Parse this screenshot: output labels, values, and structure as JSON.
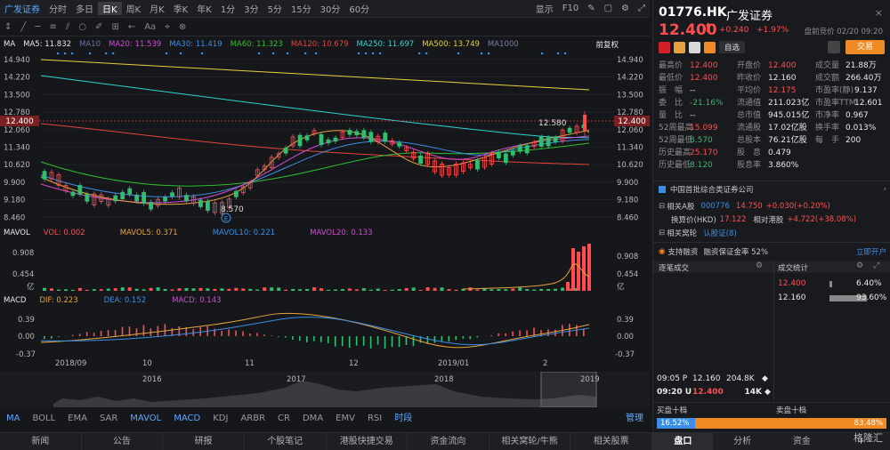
{
  "topbar": {
    "items": [
      "广发证券",
      "分时",
      "多日",
      "日K",
      "周K",
      "月K",
      "季K",
      "年K",
      "1分",
      "3分",
      "5分",
      "15分",
      "30分",
      "60分"
    ],
    "active": 3,
    "display": "显示",
    "f10": "F10"
  },
  "ma_line": {
    "label": "MA",
    "items": [
      {
        "t": "MA5: 11.832",
        "c": "#e6e6e6"
      },
      {
        "t": "MA10",
        "c": "#6f6fa0"
      },
      {
        "t": "MA20: 11.539",
        "c": "#d24bd2"
      },
      {
        "t": "MA30: 11.419",
        "c": "#3a8ee6"
      },
      {
        "t": "MA60: 11.323",
        "c": "#2fbf2f"
      },
      {
        "t": "MA120: 10.679",
        "c": "#e2463a"
      },
      {
        "t": "MA250: 11.697",
        "c": "#2fd3d3"
      },
      {
        "t": "MA500: 13.749",
        "c": "#e6d33a"
      },
      {
        "t": "MA1000",
        "c": "#7b7ba0"
      }
    ],
    "adj": "前复权"
  },
  "price_axis": [
    "14.940",
    "14.220",
    "13.500",
    "12.780",
    "12.060",
    "11.340",
    "10.620",
    "9.900",
    "9.180",
    "8.460"
  ],
  "price_marker": "12.400",
  "annot_high": "12.580",
  "annot_low": "8.570",
  "vol_line": {
    "label": "MAVOL",
    "items": [
      {
        "t": "VOL: 0.002",
        "c": "#ff4d4f"
      },
      {
        "t": "MAVOL5: 0.371",
        "c": "#e6a23c"
      },
      {
        "t": "MAVOL10: 0.221",
        "c": "#3a8ee6"
      },
      {
        "t": "MAVOL20: 0.133",
        "c": "#d24bd2"
      }
    ]
  },
  "vol_axis": [
    "0.908",
    "0.454",
    "亿"
  ],
  "macd_line": {
    "label": "MACD",
    "items": [
      {
        "t": "DIF: 0.223",
        "c": "#e6a23c"
      },
      {
        "t": "DEA: 0.152",
        "c": "#3a8ee6"
      },
      {
        "t": "MACD: 0.143",
        "c": "#d24bd2"
      }
    ]
  },
  "macd_axis": [
    "0.39",
    "0.00",
    "-0.37"
  ],
  "date_axis": [
    "2018/09",
    "10",
    "11",
    "12",
    "2019/01",
    "2"
  ],
  "year_axis": [
    "2016",
    "2017",
    "2018",
    "2019"
  ],
  "ind_tabs": {
    "items": [
      "MA",
      "BOLL",
      "EMA",
      "SAR",
      "MAVOL",
      "MACD",
      "KDJ",
      "ARBR",
      "CR",
      "DMA",
      "EMV",
      "RSI",
      "时段"
    ],
    "manage": "管理"
  },
  "bottom_tabs": [
    "新闻",
    "公告",
    "研报",
    "个股笔记",
    "港股快捷交易",
    "资金流向",
    "相关窝轮/牛熊",
    "相关股票"
  ],
  "quote": {
    "code": "01776.HK",
    "name": "广发证券",
    "price": "12.400",
    "arrow": "⬆",
    "change": "+0.240",
    "pct": "+1.97%",
    "status": "盘前竞价 02/20 09:20",
    "watch": "自选",
    "trade": "交易"
  },
  "stats": [
    [
      "最高价",
      "12.400",
      "up",
      "开盘价",
      "12.400",
      "up",
      "成交量",
      "21.88万",
      "w"
    ],
    [
      "最低价",
      "12.400",
      "up",
      "昨收价",
      "12.160",
      "w",
      "成交额",
      "266.40万",
      "w"
    ],
    [
      "振　幅",
      "--",
      "w",
      "平均价",
      "12.175",
      "up",
      "市盈率(静)",
      "9.137",
      "w"
    ],
    [
      "委　比",
      "-21.16%",
      "dn",
      "流通值",
      "211.023亿",
      "w",
      "市盈率TTM",
      "12.601",
      "w"
    ],
    [
      "量　比",
      "--",
      "w",
      "总市值",
      "945.015亿",
      "w",
      "市净率",
      "0.967",
      "w"
    ],
    [
      "52周最高",
      "15.099",
      "up",
      "流通股",
      "17.02亿股",
      "w",
      "换手率",
      "0.013%",
      "w"
    ],
    [
      "52周最低",
      "8.570",
      "dn",
      "总股本",
      "76.21亿股",
      "w",
      "每　手",
      "200",
      "w"
    ],
    [
      "历史最高",
      "25.170",
      "up",
      "股　息",
      "0.479",
      "w",
      "",
      "",
      " "
    ],
    [
      "历史最低",
      "8.120",
      "dn",
      "股息率",
      "3.860%",
      "w",
      "",
      "",
      ""
    ]
  ],
  "concept": "中国首批综合类证券公司",
  "a_share": {
    "label": "相关A股",
    "code": "000776",
    "price": "14.750",
    "chg": "+0.030(+0.20%)",
    "calc_label": "换算价(HKD)",
    "calc": "17.122",
    "prem_label": "相对港股",
    "prem": "+4.722(+38.08%)"
  },
  "warrant": {
    "label": "相关窝轮",
    "value": "认股证(8)"
  },
  "margin": {
    "text": "支持融资",
    "ratio": "融资保证金率 52%",
    "open": "立即开户"
  },
  "ticks": {
    "title": "逐笔成交",
    "rows": [
      {
        "time": "09:05 P",
        "price": "12.160",
        "vol": "204.8K"
      },
      {
        "time": "09:20 U",
        "price": "12.400",
        "vol": "14K"
      }
    ]
  },
  "dist": {
    "title": "成交统计",
    "rows": [
      {
        "price": "12.400",
        "pct": "6.40%"
      },
      {
        "price": "12.160",
        "pct": "93.60%"
      }
    ]
  },
  "orderbook": {
    "buy": "买盘十档",
    "sell": "卖盘十档",
    "buy_pct": "16.52%",
    "sell_pct": "83.48%",
    "buy_ratio": 0.1652
  },
  "right_tabs": [
    "盘口",
    "分析",
    "资金",
    "+"
  ],
  "watermark": "格隆汇",
  "colors": {
    "up": "#ff4d4f",
    "down": "#3cb371",
    "accent": "#f08a24",
    "bg": "#16171b"
  }
}
